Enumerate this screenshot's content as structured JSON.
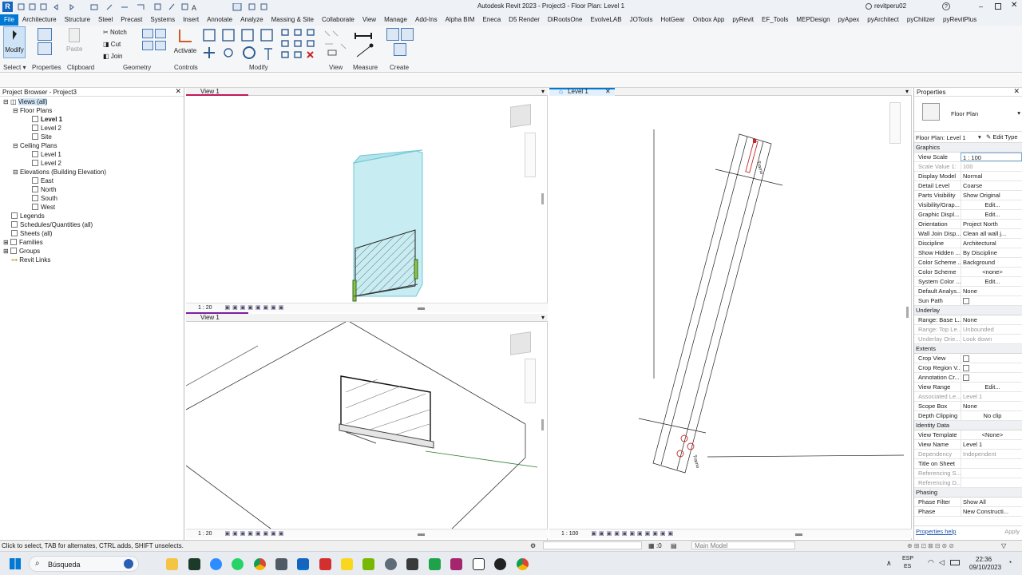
{
  "title": "Autodesk Revit 2023 - Project3 - Floor Plan: Level 1",
  "user": "revitperu02",
  "tabs": [
    "File",
    "Architecture",
    "Structure",
    "Steel",
    "Precast",
    "Systems",
    "Insert",
    "Annotate",
    "Analyze",
    "Massing & Site",
    "Collaborate",
    "View",
    "Manage",
    "Add-Ins",
    "Alpha BIM",
    "Eneca",
    "D5 Render",
    "DiRootsOne",
    "EvolveLAB",
    "JOTools",
    "HotGear",
    "Onbox App",
    "pyRevit",
    "EF_Tools",
    "MEPDesign",
    "pyApex",
    "pyArchitect",
    "pyChilizer",
    "pyRevitPlus"
  ],
  "ribbon": {
    "modify": "Modify",
    "notch": "Notch",
    "cut": "Cut",
    "join": "Join",
    "paste": "Paste",
    "activate": "Activate",
    "groups": {
      "select": "Select",
      "properties": "Properties",
      "clipboard": "Clipboard",
      "geometry": "Geometry",
      "controls": "Controls",
      "modify": "Modify",
      "view": "View",
      "measure": "Measure",
      "create": "Create"
    }
  },
  "browser": {
    "title": "Project Browser - Project3",
    "views_all": "Views (all)",
    "floor_plans": "Floor Plans",
    "fp_items": [
      "Level 1",
      "Level 2",
      "Site"
    ],
    "ceiling_plans": "Ceiling Plans",
    "cp_items": [
      "Level 1",
      "Level 2"
    ],
    "elevations": "Elevations (Building Elevation)",
    "el_items": [
      "East",
      "North",
      "South",
      "West"
    ],
    "legends": "Legends",
    "schedules": "Schedules/Quantities (all)",
    "sheets": "Sheets (all)",
    "families": "Families",
    "groups": "Groups",
    "links": "Revit Links"
  },
  "views": {
    "top_left_title": "View 1",
    "bottom_left_title": "View 1",
    "right_title": "Level 1",
    "scale_3d": "1 : 20",
    "scale_plan": "1 : 100"
  },
  "props": {
    "title": "Properties",
    "type": "Floor Plan",
    "selector": "Floor Plan: Level 1",
    "edit_type": "Edit Type",
    "sections": {
      "graphics": "Graphics",
      "underlay": "Underlay",
      "extents": "Extents",
      "identity": "Identity Data",
      "phasing": "Phasing"
    },
    "graphics": [
      [
        "View Scale",
        "1 : 100"
      ],
      [
        "Scale Value    1:",
        "100"
      ],
      [
        "Display Model",
        "Normal"
      ],
      [
        "Detail Level",
        "Coarse"
      ],
      [
        "Parts Visibility",
        "Show Original"
      ],
      [
        "Visibility/Grap...",
        "Edit..."
      ],
      [
        "Graphic Displ...",
        "Edit..."
      ],
      [
        "Orientation",
        "Project North"
      ],
      [
        "Wall Join Disp...",
        "Clean all wall j..."
      ],
      [
        "Discipline",
        "Architectural"
      ],
      [
        "Show Hidden ...",
        "By Discipline"
      ],
      [
        "Color Scheme ...",
        "Background"
      ],
      [
        "Color Scheme",
        "<none>"
      ],
      [
        "System Color ...",
        "Edit..."
      ],
      [
        "Default Analys...",
        "None"
      ],
      [
        "Sun Path",
        ""
      ]
    ],
    "underlay": [
      [
        "Range: Base L...",
        "None"
      ],
      [
        "Range: Top Le...",
        "Unbounded"
      ],
      [
        "Underlay Orie...",
        "Look down"
      ]
    ],
    "extents": [
      [
        "Crop View",
        ""
      ],
      [
        "Crop Region V...",
        ""
      ],
      [
        "Annotation Cr...",
        ""
      ],
      [
        "View Range",
        "Edit..."
      ],
      [
        "Associated Le...",
        "Level 1"
      ],
      [
        "Scope Box",
        "None"
      ],
      [
        "Depth Clipping",
        "No clip"
      ]
    ],
    "identity": [
      [
        "View Template",
        "<None>"
      ],
      [
        "View Name",
        "Level 1"
      ],
      [
        "Dependency",
        "Independent"
      ],
      [
        "Title on Sheet",
        ""
      ],
      [
        "Referencing S...",
        ""
      ],
      [
        "Referencing D...",
        ""
      ]
    ],
    "phasing": [
      [
        "Phase Filter",
        "Show All"
      ],
      [
        "Phase",
        "New Constructi..."
      ]
    ],
    "help": "Properties help",
    "apply": "Apply"
  },
  "status": {
    "hint": "Click to select, TAB for alternates, CTRL adds, SHIFT unselects.",
    "zero": ":0",
    "model": "Main Model"
  },
  "taskbar": {
    "search": "Búsqueda",
    "lang1": "ESP",
    "lang2": "ES",
    "time": "22:36",
    "date": "09/10/2023"
  }
}
